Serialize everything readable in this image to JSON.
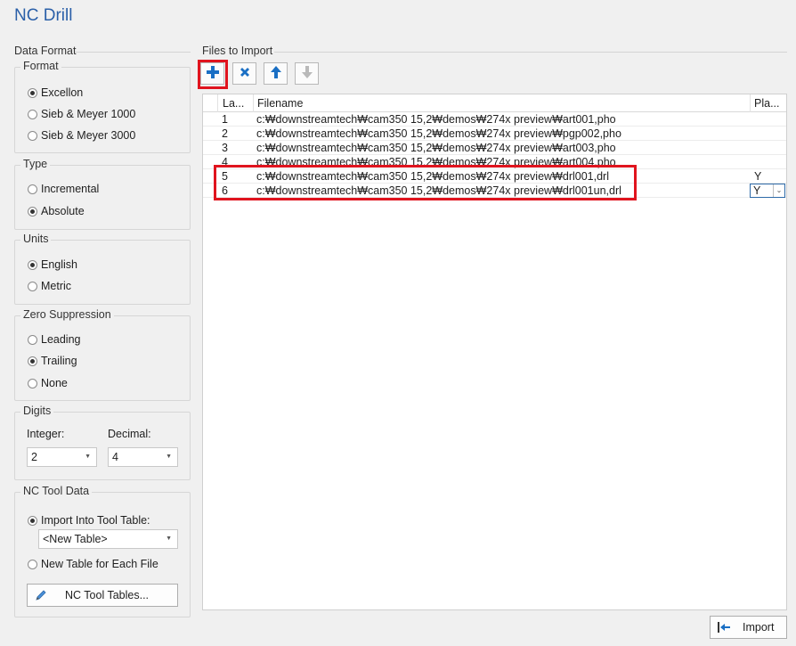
{
  "window": {
    "title": "NC Drill"
  },
  "left": {
    "section_label": "Data Format",
    "format": {
      "title": "Format",
      "options": [
        {
          "label": "Excellon",
          "checked": true
        },
        {
          "label": "Sieb & Meyer 1000",
          "checked": false
        },
        {
          "label": "Sieb & Meyer 3000",
          "checked": false
        }
      ]
    },
    "type": {
      "title": "Type",
      "options": [
        {
          "label": "Incremental",
          "checked": false
        },
        {
          "label": "Absolute",
          "checked": true
        }
      ]
    },
    "units": {
      "title": "Units",
      "options": [
        {
          "label": "English",
          "checked": true
        },
        {
          "label": "Metric",
          "checked": false
        }
      ]
    },
    "zero_suppression": {
      "title": "Zero Suppression",
      "options": [
        {
          "label": "Leading",
          "checked": false
        },
        {
          "label": "Trailing",
          "checked": true
        },
        {
          "label": "None",
          "checked": false
        }
      ]
    },
    "digits": {
      "title": "Digits",
      "integer_label": "Integer:",
      "integer_value": "2",
      "decimal_label": "Decimal:",
      "decimal_value": "4"
    },
    "nc_tool_data": {
      "title": "NC Tool Data",
      "import_label": "Import Into Tool Table:",
      "import_checked": true,
      "table_value": "<New Table>",
      "new_table_label": "New Table for Each File",
      "new_table_checked": false,
      "tables_button": "NC Tool Tables..."
    }
  },
  "files": {
    "section_label": "Files to Import",
    "toolbar": {
      "add_icon": "plus-icon",
      "remove_icon": "x-icon",
      "up_icon": "arrow-up-icon",
      "down_icon": "arrow-down-icon"
    },
    "columns": [
      "La...",
      "Filename",
      "Pla..."
    ],
    "rows": [
      {
        "layer": "1",
        "filename": "c:₩downstreamtech₩cam350 15,2₩demos₩274x preview₩art001,pho",
        "plated": ""
      },
      {
        "layer": "2",
        "filename": "c:₩downstreamtech₩cam350 15,2₩demos₩274x preview₩pgp002,pho",
        "plated": ""
      },
      {
        "layer": "3",
        "filename": "c:₩downstreamtech₩cam350 15,2₩demos₩274x preview₩art003,pho",
        "plated": ""
      },
      {
        "layer": "4",
        "filename": "c:₩downstreamtech₩cam350 15,2₩demos₩274x preview₩art004,pho",
        "plated": ""
      },
      {
        "layer": "5",
        "filename": "c:₩downstreamtech₩cam350 15,2₩demos₩274x preview₩drl001,drl",
        "plated": "Y"
      },
      {
        "layer": "6",
        "filename": "c:₩downstreamtech₩cam350 15,2₩demos₩274x preview₩drl001un,drl",
        "plated": "Y"
      }
    ]
  },
  "footer": {
    "import_label": "Import",
    "import_icon": "import-arrow-icon"
  },
  "colors": {
    "title": "#2a5fa8",
    "accent": "#1a6fc4",
    "highlight": "#e0141e"
  }
}
